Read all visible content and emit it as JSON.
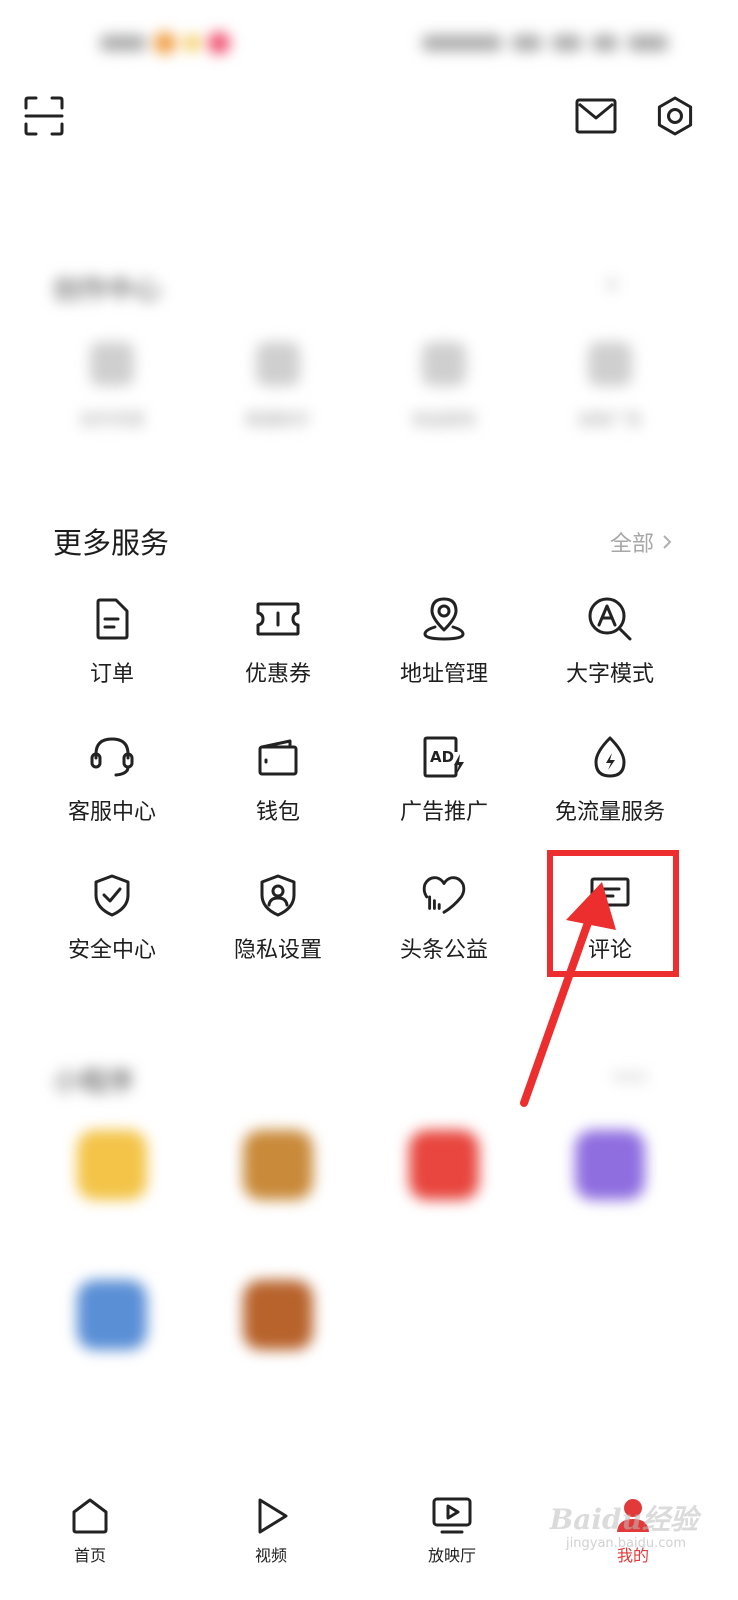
{
  "status_bar": {
    "left_text": "",
    "right_text": ""
  },
  "header": {
    "scan_icon": "scan-icon",
    "mail_icon": "mail-icon",
    "settings_icon": "gear-icon"
  },
  "creator_center": {
    "title": "创作中心",
    "items": [
      {
        "label": "创作灵感",
        "icon": "bulb-icon"
      },
      {
        "label": "数据助手",
        "icon": "chart-icon"
      },
      {
        "label": "收益提现",
        "icon": "coin-icon"
      },
      {
        "label": "自助广告",
        "icon": "flag-icon"
      }
    ]
  },
  "more_services": {
    "title": "更多服务",
    "all_label": "全部",
    "items": [
      {
        "label": "订单",
        "icon": "order-icon"
      },
      {
        "label": "优惠券",
        "icon": "coupon-icon"
      },
      {
        "label": "地址管理",
        "icon": "location-icon"
      },
      {
        "label": "大字模式",
        "icon": "font-zoom-icon"
      },
      {
        "label": "客服中心",
        "icon": "headset-icon"
      },
      {
        "label": "钱包",
        "icon": "wallet-icon"
      },
      {
        "label": "广告推广",
        "icon": "ad-icon"
      },
      {
        "label": "免流量服务",
        "icon": "data-drop-icon"
      },
      {
        "label": "安全中心",
        "icon": "shield-check-icon"
      },
      {
        "label": "隐私设置",
        "icon": "privacy-shield-icon"
      },
      {
        "label": "头条公益",
        "icon": "charity-heart-icon"
      },
      {
        "label": "评论",
        "icon": "comment-icon"
      }
    ]
  },
  "mini_programs": {
    "title": "小程序",
    "items": [
      {
        "label": "",
        "color": "#f3c448"
      },
      {
        "label": "",
        "color": "#c98a3a"
      },
      {
        "label": "",
        "color": "#e8463e"
      },
      {
        "label": "",
        "color": "#8f6ee0"
      },
      {
        "label": "",
        "color": "#5a8fd6"
      },
      {
        "label": "",
        "color": "#b8632c"
      }
    ]
  },
  "tabbar": {
    "items": [
      {
        "label": "首页",
        "icon": "home-icon"
      },
      {
        "label": "视频",
        "icon": "play-icon"
      },
      {
        "label": "放映厅",
        "icon": "tv-icon"
      },
      {
        "label": "我的",
        "icon": "profile-icon",
        "active": true
      }
    ]
  },
  "watermark": {
    "text": "Baidu经验",
    "sub": "jingyan.baidu.com"
  },
  "colors": {
    "accent": "#e23a3a",
    "highlight": "#ec2e2e"
  }
}
